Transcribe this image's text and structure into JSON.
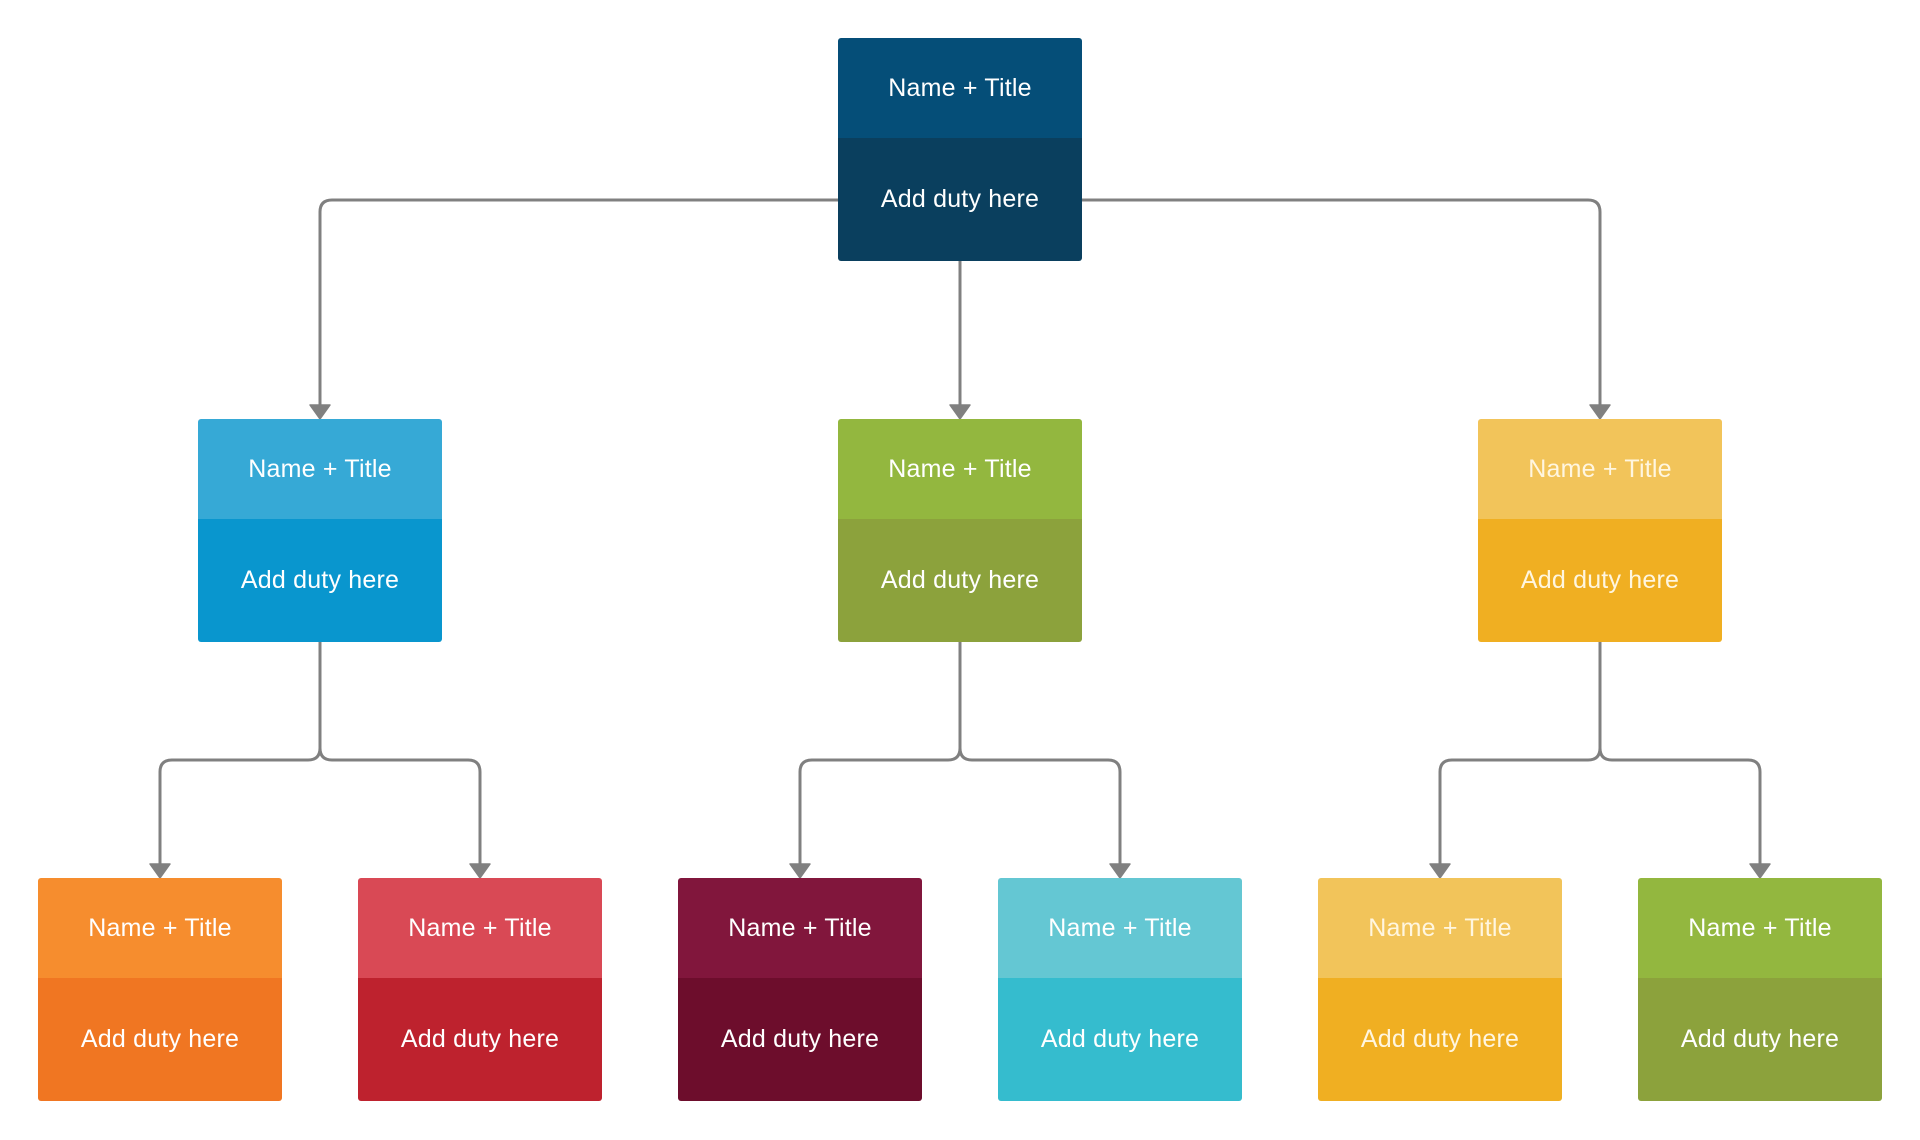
{
  "diagram": {
    "type": "org-chart",
    "connector_color": "#808080",
    "nodes": [
      {
        "id": "root",
        "level": 1,
        "parent": null,
        "title": "Name + Title",
        "duty": "Add duty here",
        "header_color": "#054E78",
        "body_color": "#0A3F5E"
      },
      {
        "id": "l2-a",
        "level": 2,
        "parent": "root",
        "title": "Name + Title",
        "duty": "Add duty here",
        "header_color": "#36A9D6",
        "body_color": "#0996CE"
      },
      {
        "id": "l2-b",
        "level": 2,
        "parent": "root",
        "title": "Name + Title",
        "duty": "Add duty here",
        "header_color": "#93B73F",
        "body_color": "#8CA23C"
      },
      {
        "id": "l2-c",
        "level": 2,
        "parent": "root",
        "title": "Name + Title",
        "duty": "Add duty here",
        "header_color": "#F2C45A",
        "body_color": "#F0AF22"
      },
      {
        "id": "l3-a",
        "level": 3,
        "parent": "l2-a",
        "title": "Name + Title",
        "duty": "Add duty here",
        "header_color": "#F68D2E",
        "body_color": "#F07622"
      },
      {
        "id": "l3-b",
        "level": 3,
        "parent": "l2-a",
        "title": "Name + Title",
        "duty": "Add duty here",
        "header_color": "#D94955",
        "body_color": "#BE222E"
      },
      {
        "id": "l3-c",
        "level": 3,
        "parent": "l2-b",
        "title": "Name + Title",
        "duty": "Add duty here",
        "header_color": "#81163C",
        "body_color": "#6D0D2C"
      },
      {
        "id": "l3-d",
        "level": 3,
        "parent": "l2-b",
        "title": "Name + Title",
        "duty": "Add duty here",
        "header_color": "#64C7D3",
        "body_color": "#35BCCE"
      },
      {
        "id": "l3-e",
        "level": 3,
        "parent": "l2-c",
        "title": "Name + Title",
        "duty": "Add duty here",
        "header_color": "#F2C45A",
        "body_color": "#F0AF22"
      },
      {
        "id": "l3-f",
        "level": 3,
        "parent": "l2-c",
        "title": "Name + Title",
        "duty": "Add duty here",
        "header_color": "#93B73F",
        "body_color": "#8CA23C"
      }
    ]
  }
}
